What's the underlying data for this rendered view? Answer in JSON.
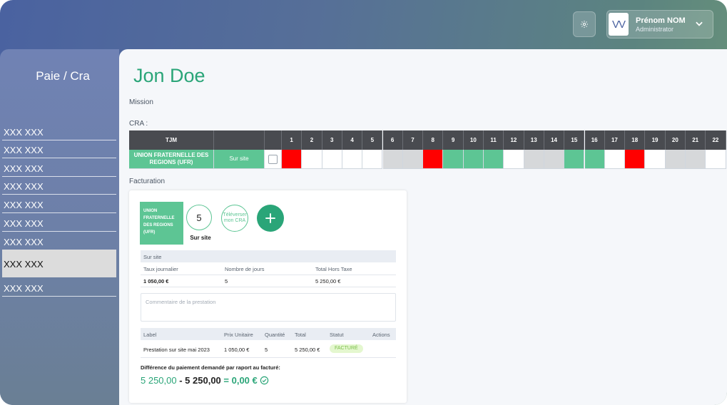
{
  "header": {
    "user_initials": "VV",
    "user_name": "Prénom NOM",
    "user_role": "Administrator"
  },
  "sidebar": {
    "title": "Paie / Cra",
    "items": [
      {
        "label": "XXX XXX",
        "active": false
      },
      {
        "label": "XXX XXX",
        "active": false
      },
      {
        "label": "XXX XXX",
        "active": false
      },
      {
        "label": "XXX XXX",
        "active": false
      },
      {
        "label": "XXX XXX",
        "active": false
      },
      {
        "label": "XXX XXX",
        "active": false
      },
      {
        "label": "XXX XXX",
        "active": false
      },
      {
        "label": "XXX XXX",
        "active": true
      },
      {
        "label": "XXX XXX",
        "active": false
      }
    ]
  },
  "main": {
    "title": "Jon Doe",
    "mission_label": "Mission",
    "cra_label": "CRA :",
    "facturation_label": "Facturation"
  },
  "cra": {
    "header_tjm": "TJM",
    "org": "UNION FRATERNELLE DES REGIONS (UFR)",
    "location": "Sur site",
    "days": [
      "1",
      "2",
      "3",
      "4",
      "5",
      "6",
      "7",
      "8",
      "9",
      "10",
      "11",
      "12",
      "13",
      "14",
      "15",
      "16",
      "17",
      "18",
      "19",
      "20",
      "21",
      "22"
    ],
    "day_status": [
      "red",
      "white",
      "white",
      "white",
      "white",
      "grey",
      "grey",
      "red",
      "green",
      "green",
      "green",
      "white",
      "grey",
      "grey",
      "green",
      "green",
      "white",
      "red",
      "white",
      "grey",
      "grey",
      "white"
    ]
  },
  "facturation": {
    "tile_text": "UNION FRATERNELLE DES REGIONS (UFR)",
    "days_count": "5",
    "days_label": "Sur site",
    "upload_label": "Téléverser mon CRA",
    "section_label": "Sur site",
    "rate_headers": [
      "Taux journalier",
      "Nombre de jours",
      "Total Hors Taxe"
    ],
    "rate_values": [
      "1 050,00 €",
      "5",
      "5 250,00 €"
    ],
    "comment_placeholder": "Commentaire de la prestation",
    "line_headers": [
      "Label",
      "Prix Unitaire",
      "Quantité",
      "Total",
      "Statut",
      "Actions"
    ],
    "line_values": [
      "Prestation sur site mai 2023",
      "1 050,00 €",
      "5",
      "5 250,00 €",
      "FACTURÉ"
    ],
    "diff_label": "Différence du paiement demandé par raport au facturé:",
    "diff_requested": "5 250,00",
    "diff_minus": "- 5 250,00",
    "diff_result": "= 0,00 €"
  },
  "colors": {
    "accent": "#2aa578",
    "tile_green": "#5dc594",
    "red": "#ff0000",
    "grey": "#d6d8da"
  }
}
